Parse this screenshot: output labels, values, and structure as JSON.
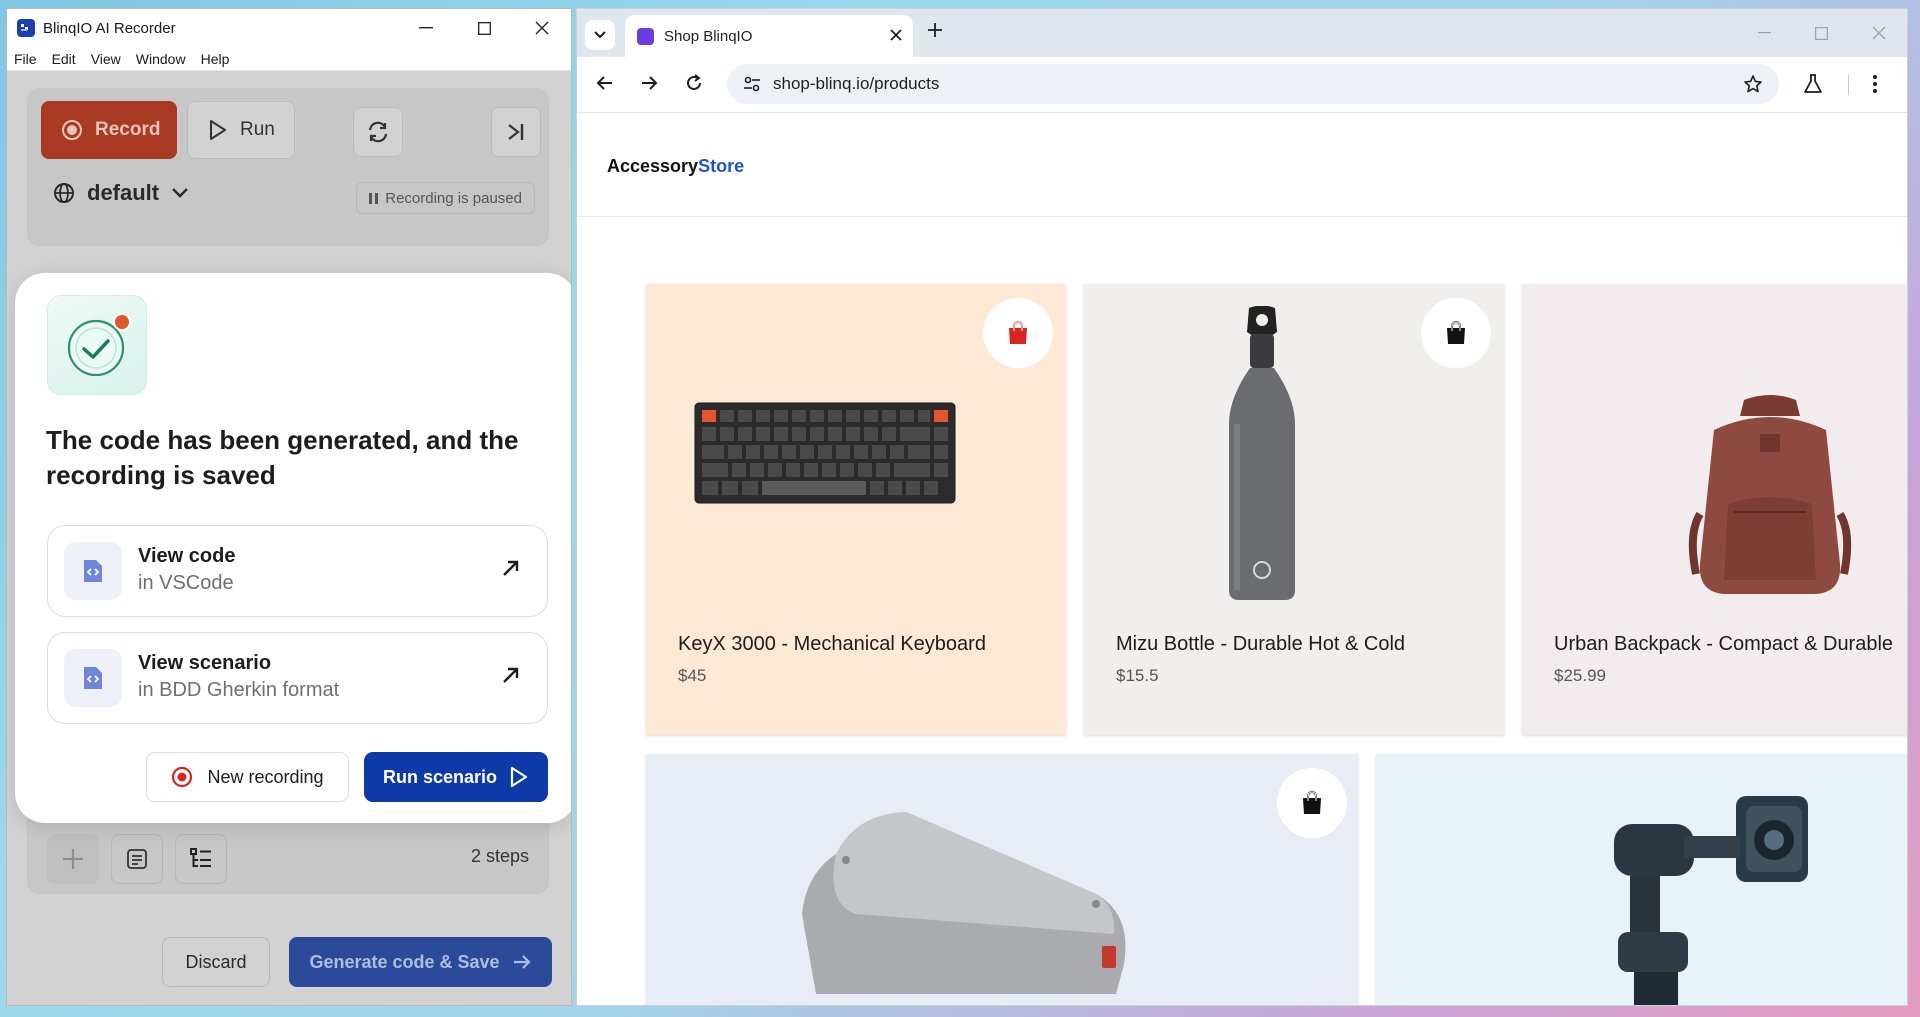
{
  "recorder": {
    "title": "BlinqIO AI Recorder",
    "menu": [
      "File",
      "Edit",
      "View",
      "Window",
      "Help"
    ],
    "record_label": "Record",
    "run_label": "Run",
    "environment": "default",
    "status": "Recording is paused",
    "steps_count": "2 steps",
    "discard_label": "Discard",
    "generate_label": "Generate code & Save",
    "dialog": {
      "title": "The code has been generated, and the recording is saved",
      "options": [
        {
          "title": "View code",
          "subtitle": "in VSCode"
        },
        {
          "title": "View scenario",
          "subtitle": "in BDD Gherkin format"
        }
      ],
      "new_recording_label": "New recording",
      "run_scenario_label": "Run scenario"
    }
  },
  "browser": {
    "tab_title": "Shop BlinqIO",
    "url": "shop-blinq.io/products",
    "brand_main": "Accessory",
    "brand_accent": "Store",
    "products": [
      {
        "name": "KeyX 3000 - Mechanical Keyboard",
        "price": "$45",
        "bg": "#fde9d5"
      },
      {
        "name": "Mizu Bottle - Durable Hot & Cold",
        "price": "$15.5",
        "bg": "#f0efee"
      },
      {
        "name": "Urban Backpack - Compact & Durable",
        "price": "$25.99",
        "bg": "#f2ecee"
      },
      {
        "name": "",
        "price": "",
        "bg": "#e8ecf4"
      },
      {
        "name": "",
        "price": "",
        "bg": "#e9f3f7"
      }
    ]
  },
  "colors": {
    "record_button": "#a93a22",
    "run_scenario_button": "#0d3aa8",
    "brand_accent": "#2153c8",
    "cart_icon_active": "#d7261f"
  }
}
